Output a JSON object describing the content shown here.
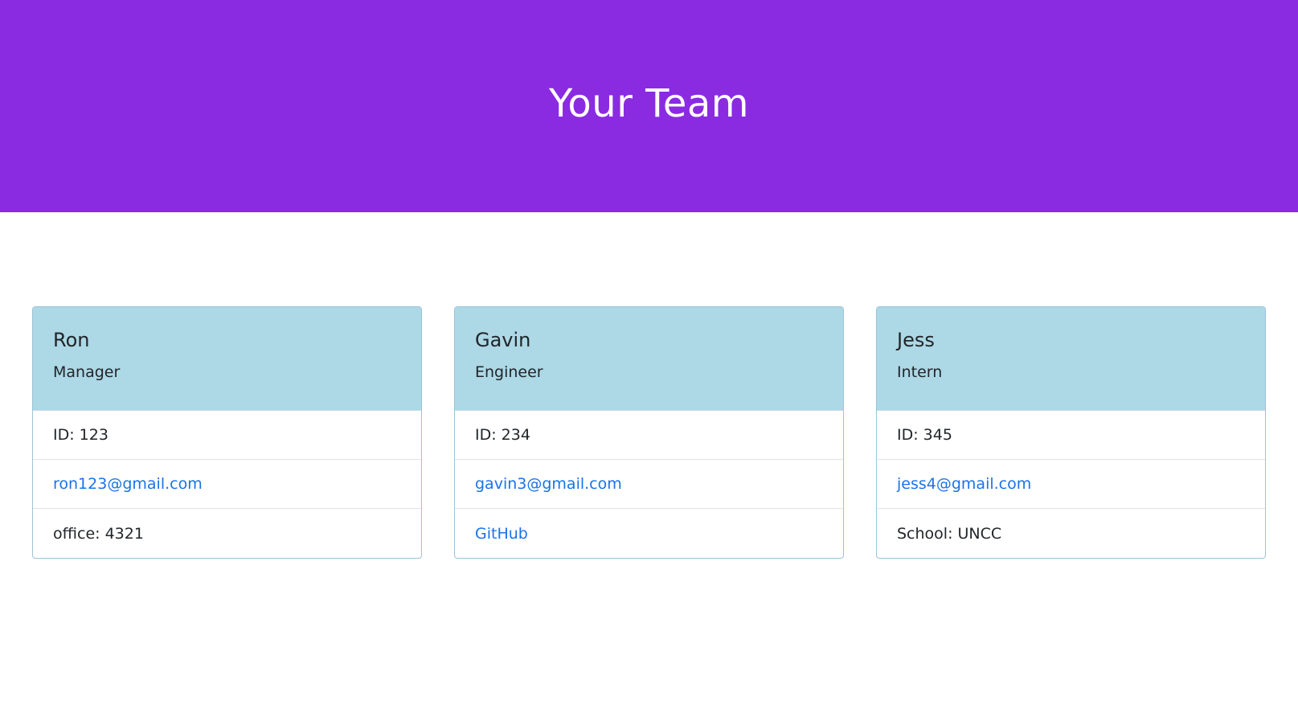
{
  "header": {
    "title": "Your Team"
  },
  "colors": {
    "header_bg": "#8a2be2",
    "card_header_bg": "#add8e6",
    "link": "#1a73e8"
  },
  "team": [
    {
      "name": "Ron",
      "role": "Manager",
      "id": "ID: 123",
      "email": "ron123@gmail.com",
      "extra": "office: 4321"
    },
    {
      "name": "Gavin",
      "role": "Engineer",
      "id": "ID: 234",
      "email": "gavin3@gmail.com",
      "extra": "GitHub"
    },
    {
      "name": "Jess",
      "role": "Intern",
      "id": "ID: 345",
      "email": "jess4@gmail.com",
      "extra": "School: UNCC"
    }
  ]
}
